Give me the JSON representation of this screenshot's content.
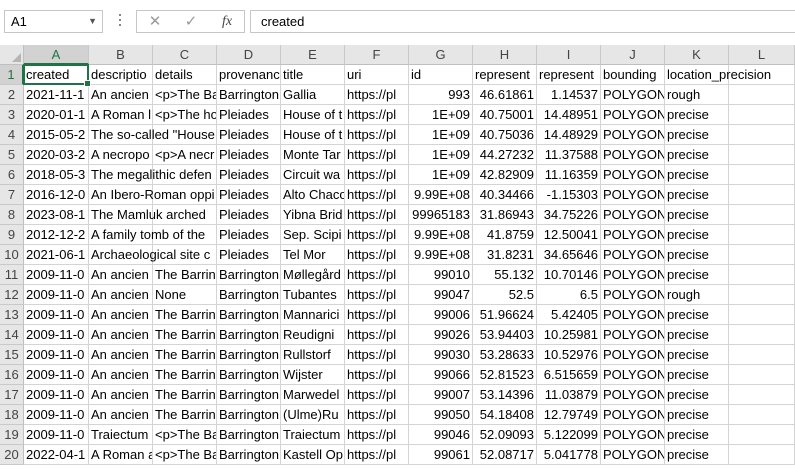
{
  "formula_bar": {
    "name_box": "A1",
    "formula": "created",
    "cancel_icon": "✕",
    "enter_icon": "✓",
    "fx_label": "fx"
  },
  "columns": [
    "A",
    "B",
    "C",
    "D",
    "E",
    "F",
    "G",
    "H",
    "I",
    "J",
    "K",
    "L"
  ],
  "numeric_columns": [
    6,
    7,
    8
  ],
  "rows": [
    [
      "created",
      "descriptio",
      "details",
      "provenanc",
      "title",
      "uri",
      "id",
      "represent",
      "represent",
      "bounding",
      "location_precision",
      ""
    ],
    [
      "2021-11-1",
      "An ancien",
      "<p>The Ba",
      "Barrington",
      "Gallia",
      "https://pl",
      "993",
      "46.61861",
      "1.14537",
      "POLYGON",
      "rough",
      ""
    ],
    [
      "2020-01-1",
      "A Roman l",
      "<p>The ho",
      "Pleiades",
      "House of t",
      "https://pl",
      "1E+09",
      "40.75001",
      "14.48951",
      "POLYGON",
      "precise",
      ""
    ],
    [
      "2015-05-2",
      "The so-called \"House",
      "",
      "Pleiades",
      "House of t",
      "https://pl",
      "1E+09",
      "40.75036",
      "14.48929",
      "POLYGON",
      "precise",
      ""
    ],
    [
      "2020-03-2",
      "A necropo",
      "<p>A necr",
      "Pleiades",
      "Monte Tar",
      "https://pl",
      "1E+09",
      "44.27232",
      "11.37588",
      "POLYGON",
      "precise",
      ""
    ],
    [
      "2018-05-3",
      "The megalithic defen",
      "",
      "Pleiades",
      "Circuit wa",
      "https://pl",
      "1E+09",
      "42.82909",
      "11.16359",
      "POLYGON",
      "precise",
      ""
    ],
    [
      "2016-12-0",
      "An Ibero-Roman oppi",
      "",
      "Pleiades",
      "Alto Chaco",
      "https://pl",
      "9.99E+08",
      "40.34466",
      "-1.15303",
      "POLYGON",
      "precise",
      ""
    ],
    [
      "2023-08-1",
      "The Mamluk arched",
      "",
      "Pleiades",
      "Yibna Brid",
      "https://pl",
      "99965183",
      "31.86943",
      "34.75226",
      "POLYGON",
      "precise",
      ""
    ],
    [
      "2012-12-2",
      "A family tomb of the",
      "",
      "Pleiades",
      "Sep. Scipi",
      "https://pl",
      "9.99E+08",
      "41.8759",
      "12.50041",
      "POLYGON",
      "precise",
      ""
    ],
    [
      "2021-06-1",
      "Archaeological site c",
      "",
      "Pleiades",
      "Tel Mor",
      "https://pl",
      "9.99E+08",
      "31.8231",
      "34.65646",
      "POLYGON",
      "precise",
      ""
    ],
    [
      "2009-11-0",
      "An ancien",
      "The Barrin",
      "Barrington",
      "Møllegård",
      "https://pl",
      "99010",
      "55.132",
      "10.70146",
      "POLYGON",
      "precise",
      ""
    ],
    [
      "2009-11-0",
      "An ancien",
      "None",
      "Barrington",
      "Tubantes",
      "https://pl",
      "99047",
      "52.5",
      "6.5",
      "POLYGON",
      "rough",
      ""
    ],
    [
      "2009-11-0",
      "An ancien",
      "The Barrin",
      "Barrington",
      "Mannarici",
      "https://pl",
      "99006",
      "51.96624",
      "5.42405",
      "POLYGON",
      "precise",
      ""
    ],
    [
      "2009-11-0",
      "An ancien",
      "The Barrin",
      "Barrington",
      "Reudigni",
      "https://pl",
      "99026",
      "53.94403",
      "10.25981",
      "POLYGON",
      "precise",
      ""
    ],
    [
      "2009-11-0",
      "An ancien",
      "The Barrin",
      "Barrington",
      "Rullstorf",
      "https://pl",
      "99030",
      "53.28633",
      "10.52976",
      "POLYGON",
      "precise",
      ""
    ],
    [
      "2009-11-0",
      "An ancien",
      "The Barrin",
      "Barrington",
      "Wijster",
      "https://pl",
      "99066",
      "52.81523",
      "6.515659",
      "POLYGON",
      "precise",
      ""
    ],
    [
      "2009-11-0",
      "An ancien",
      "The Barrin",
      "Barrington",
      "Marwedel",
      "https://pl",
      "99007",
      "53.14396",
      "11.03879",
      "POLYGON",
      "precise",
      ""
    ],
    [
      "2009-11-0",
      "An ancien",
      "The Barrin",
      "Barrington",
      "(Ulme)Ru",
      "https://pl",
      "99050",
      "54.18408",
      "12.79749",
      "POLYGON",
      "precise",
      ""
    ],
    [
      "2009-11-0",
      "Traiectum",
      "<p>The Ba",
      "Barrington",
      "Traiectum",
      "https://pl",
      "99046",
      "52.09093",
      "5.122099",
      "POLYGON",
      "precise",
      ""
    ],
    [
      "2022-04-1",
      "A Roman a",
      "<p>The Ba",
      "Barrington",
      "Kastell Op",
      "https://pl",
      "99061",
      "52.08717",
      "5.041778",
      "POLYGON",
      "precise",
      ""
    ]
  ]
}
